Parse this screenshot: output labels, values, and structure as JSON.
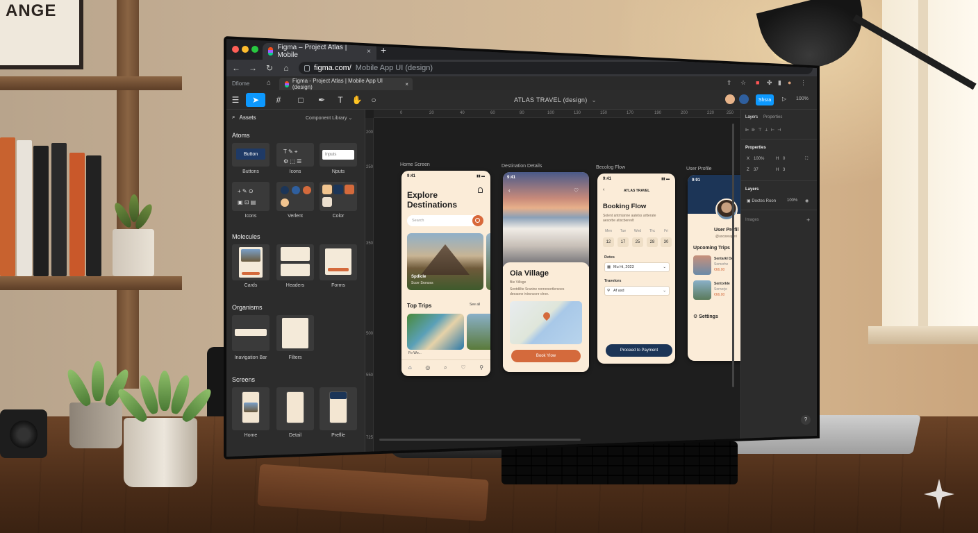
{
  "background": {
    "poster_text": "ANGE"
  },
  "browser": {
    "tab_title": "Figma – Project Atlas | Mobile",
    "tab_close": "×",
    "new_tab": "+",
    "url_host": "figma.com/",
    "url_path": "Mobile App UI (design)",
    "inner_tab_first": "Dfiome",
    "inner_tab_title": "Figma - Project Atlas | Mobile App UI (design)",
    "inner_tab_close": "×"
  },
  "toolbar": {
    "file_name": "ATLAS TRAVEL",
    "file_mode": "(design)",
    "share_label": "Shsra",
    "zoom": "100%"
  },
  "left_panel": {
    "assets_label": "Assets",
    "library_label": "Component Library ⌄",
    "sections": {
      "atoms": "Atoms",
      "molecules": "Molecules",
      "organisms": "Organisms",
      "screens": "Screens"
    },
    "atoms": {
      "buttons_label": "Buttons",
      "button_preview": "Button",
      "icons_label": "Icons",
      "inputs_label": "Nputs",
      "input_preview": "Inputs",
      "icons2_label": "Icons",
      "variant_label": "Verlent",
      "color_label": "Color"
    },
    "molecules": {
      "cards_label": "Cards",
      "headers_label": "Headers",
      "forms_label": "Forms"
    },
    "organisms": {
      "navbar_label": "Inavigation Bar",
      "filters_label": "Filters"
    },
    "screens": {
      "home_label": "Home",
      "detail_label": "Detail",
      "profile_label": "Preflle"
    }
  },
  "canvas": {
    "ruler_top": [
      "0",
      "20",
      "40",
      "60",
      "80",
      "100",
      "130",
      "150",
      "170",
      "190",
      "200",
      "220",
      "250"
    ],
    "ruler_left": [
      "200",
      "250",
      "350",
      "500",
      "550",
      "725"
    ],
    "frames": {
      "home": {
        "label": "Home Screen",
        "status_time": "9:41",
        "title_line1": "Explore",
        "title_line2": "Destinations",
        "search_placeholder": "Search",
        "card_title": "Spdicle",
        "card_subtitle": "Scorr Sronces",
        "top_trips": "Top Trips",
        "see_all": "See all",
        "trip_caption": "Fo Wo..."
      },
      "detail": {
        "label": "Destination Details",
        "status_time": "9:41",
        "title": "Oia Village",
        "subtitle": "Bie Villsge",
        "body_line1": "Sentdlilte Sranine renrorsortlersoes",
        "body_line2": "deeaone ivtrsnconr olroe.",
        "book_label": "Book Ylow"
      },
      "booking": {
        "label": "Becolog Flow",
        "status_time": "9:41",
        "brand": "ATLAS TRAVEL",
        "title": "Booking Flow",
        "desc_line1": "Solent antmtanne aatelss artterate",
        "desc_line2": "aesorbe atiscberevlt",
        "days": [
          "Men",
          "Tue",
          "Wed",
          "Thc",
          "Fri"
        ],
        "dates": [
          "12",
          "17",
          "25",
          "28",
          "30"
        ],
        "dates_label": "Detes",
        "date_value": "Mu Hi, 2023",
        "travelers_label": "Travelors",
        "travelers_value": "Af asd",
        "cta_label": "Proceed to Payment"
      },
      "profile": {
        "label": "User Profile",
        "status_time": "9:91",
        "name": "User Profil",
        "handle": "@uscareaperi",
        "upcoming": "Upcoming Trips",
        "trips": [
          {
            "name": "Sentarkl De",
            "place": "Semerhe",
            "price": "€66.00"
          },
          {
            "name": "Sentorkle",
            "place": "Sernerje",
            "price": "€66.00"
          }
        ],
        "settings": "Settings"
      }
    }
  },
  "right_panel": {
    "tab_layers": "Layers",
    "tab_properties": "Properties",
    "properties_title": "Properties",
    "x_label": "X",
    "x_value": "100%",
    "h_label": "H",
    "h_value": "0",
    "y_label": "Z",
    "y_value": "37",
    "h2_value": "3",
    "layers_title": "Layers",
    "layer_name": "Doctes Roon",
    "layer_opacity": "100%",
    "images_label": "Images",
    "help": "?"
  },
  "colors": {
    "figma_blue": "#0d99ff",
    "accent_orange": "#d46a3c",
    "navy": "#1c3557",
    "cream": "#fbecd8"
  }
}
